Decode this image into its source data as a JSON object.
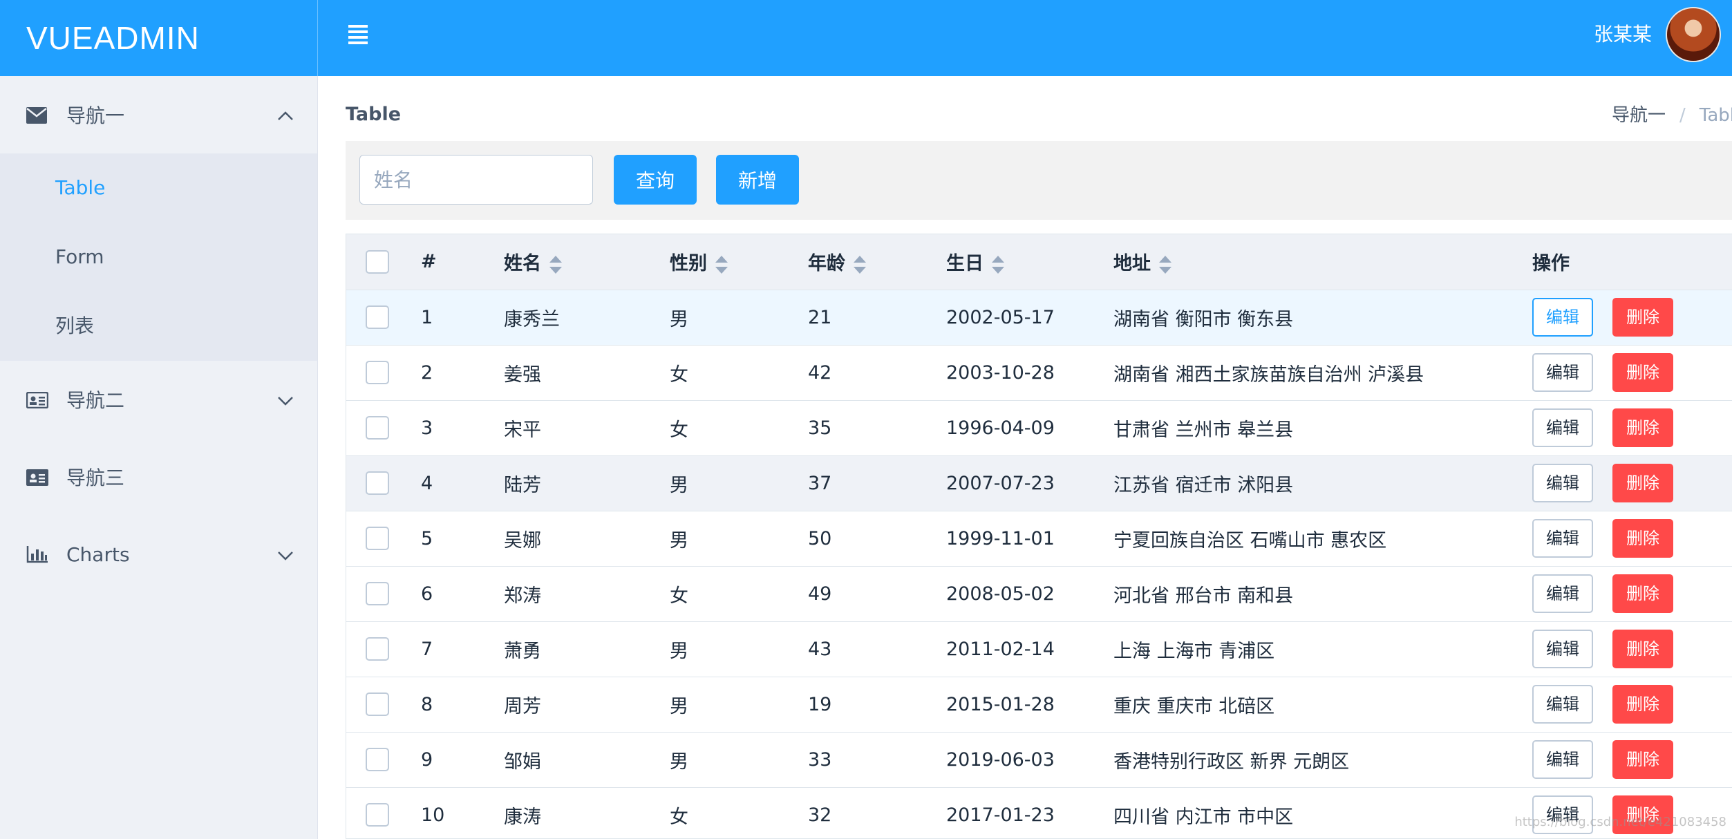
{
  "header": {
    "logo": "VUEADMIN",
    "username": "张某某"
  },
  "sidebar": {
    "groups": [
      {
        "label": "导航一",
        "icon": "envelope-icon",
        "expanded": true,
        "items": [
          {
            "label": "Table",
            "active": true
          },
          {
            "label": "Form",
            "active": false
          },
          {
            "label": "列表",
            "active": false
          }
        ]
      },
      {
        "label": "导航二",
        "icon": "id-card-icon",
        "expanded": false
      },
      {
        "label": "导航三",
        "icon": "id-badge-icon",
        "expanded": false
      },
      {
        "label": "Charts",
        "icon": "bar-chart-icon",
        "expanded": false
      }
    ]
  },
  "page": {
    "title": "Table",
    "breadcrumb": [
      "导航一",
      "Tabl"
    ]
  },
  "toolbar": {
    "search_placeholder": "姓名",
    "query_label": "查询",
    "add_label": "新增"
  },
  "table": {
    "headers": {
      "index": "#",
      "name": "姓名",
      "sex": "性别",
      "age": "年龄",
      "birth": "生日",
      "addr": "地址",
      "ops": "操作"
    },
    "edit_label": "编辑",
    "delete_label": "删除",
    "rows": [
      {
        "id": "1",
        "name": "康秀兰",
        "sex": "男",
        "age": "21",
        "birth": "2002-05-17",
        "addr": "湖南省 衡阳市 衡东县"
      },
      {
        "id": "2",
        "name": "姜强",
        "sex": "女",
        "age": "42",
        "birth": "2003-10-28",
        "addr": "湖南省 湘西土家族苗族自治州 泸溪县"
      },
      {
        "id": "3",
        "name": "宋平",
        "sex": "女",
        "age": "35",
        "birth": "1996-04-09",
        "addr": "甘肃省 兰州市 皋兰县"
      },
      {
        "id": "4",
        "name": "陆芳",
        "sex": "男",
        "age": "37",
        "birth": "2007-07-23",
        "addr": "江苏省 宿迁市 沭阳县"
      },
      {
        "id": "5",
        "name": "吴娜",
        "sex": "男",
        "age": "50",
        "birth": "1999-11-01",
        "addr": "宁夏回族自治区 石嘴山市 惠农区"
      },
      {
        "id": "6",
        "name": "郑涛",
        "sex": "女",
        "age": "49",
        "birth": "2008-05-02",
        "addr": "河北省 邢台市 南和县"
      },
      {
        "id": "7",
        "name": "萧勇",
        "sex": "男",
        "age": "43",
        "birth": "2011-02-14",
        "addr": "上海 上海市 青浦区"
      },
      {
        "id": "8",
        "name": "周芳",
        "sex": "男",
        "age": "19",
        "birth": "2015-01-28",
        "addr": "重庆 重庆市 北碚区"
      },
      {
        "id": "9",
        "name": "邹娟",
        "sex": "男",
        "age": "33",
        "birth": "2019-06-03",
        "addr": "香港特别行政区 新界 元朗区"
      },
      {
        "id": "10",
        "name": "康涛",
        "sex": "女",
        "age": "32",
        "birth": "2017-01-23",
        "addr": "四川省 内江市 市中区"
      }
    ]
  },
  "watermark": "https://blog.csdn.net/e421083458",
  "colors": {
    "primary": "#20a0ff",
    "danger": "#ff4949",
    "sidebar": "#eef1f6"
  }
}
